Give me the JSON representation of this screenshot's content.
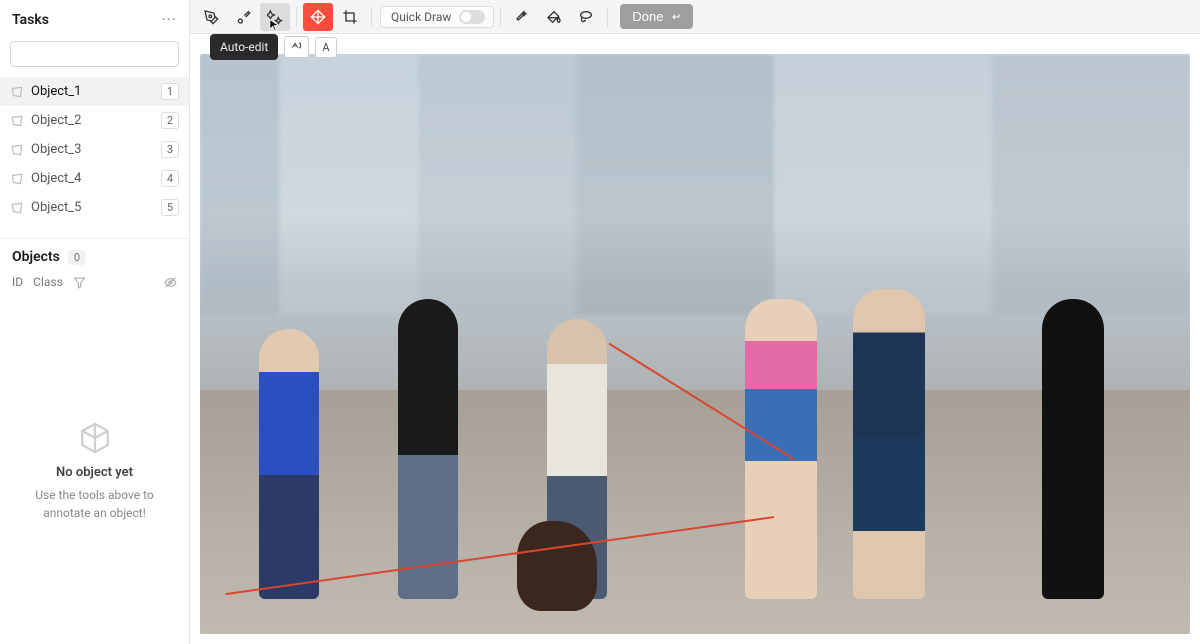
{
  "sidebar": {
    "title": "Tasks",
    "search_placeholder": "",
    "tasks": [
      {
        "label": "Object_1",
        "badge": "1",
        "selected": true
      },
      {
        "label": "Object_2",
        "badge": "2",
        "selected": false
      },
      {
        "label": "Object_3",
        "badge": "3",
        "selected": false
      },
      {
        "label": "Object_4",
        "badge": "4",
        "selected": false
      },
      {
        "label": "Object_5",
        "badge": "5",
        "selected": false
      }
    ],
    "objects_title": "Objects",
    "objects_count": "0",
    "col_id": "ID",
    "col_class": "Class",
    "empty_title": "No object yet",
    "empty_sub": "Use the tools above to annotate an object!"
  },
  "toolbar": {
    "quickdraw_label": "Quick Draw",
    "done_label": "Done",
    "tooltip_label": "Auto-edit",
    "tooltip_key": "A"
  }
}
